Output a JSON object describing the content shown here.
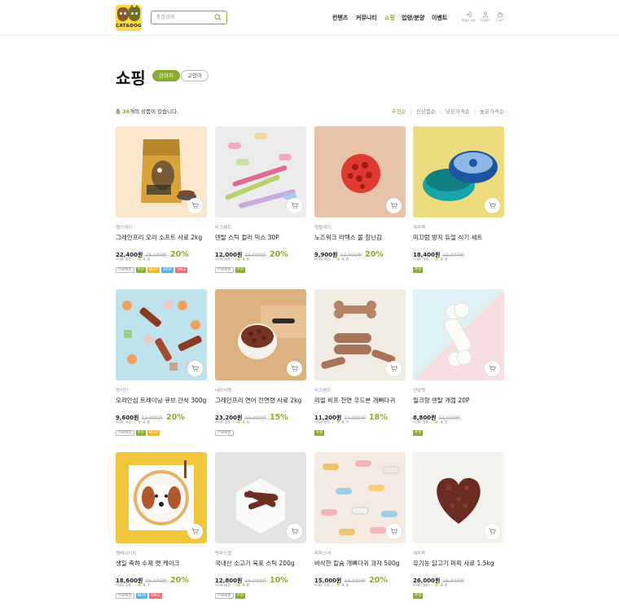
{
  "header": {
    "logo_text": "CAT&DOG",
    "search_placeholder": "통합검색",
    "nav": [
      "컨텐츠",
      "커뮤니티",
      "쇼핑",
      "입양/분양",
      "이벤트"
    ],
    "nav_active": "쇼핑",
    "utils": [
      {
        "label": "Sign up",
        "icon": "signup-icon"
      },
      {
        "label": "Login",
        "icon": "login-icon"
      },
      {
        "label": "Cart",
        "icon": "cart-icon"
      }
    ]
  },
  "page": {
    "title": "쇼핑",
    "categories": [
      "강아지",
      "고양이"
    ],
    "active_category": "강아지",
    "total_prefix": "총 ",
    "total_count": "36",
    "total_suffix": "개의 상품이 있습니다.",
    "sorts": [
      "추천순",
      "신상품순",
      "낮은가격순",
      "높은가격순"
    ],
    "active_sort": "추천순"
  },
  "tag_labels": {
    "free": "무료배송",
    "rec": "추천",
    "best": "BEST",
    "new": "NEW",
    "sale": "SALE"
  },
  "review_label": "리뷰",
  "products": [
    {
      "brand": "펫스테이",
      "name": "그레인프리 오리 소프트 사료 2kg",
      "price": "22,400원",
      "old": "28,000원",
      "disc": "20%",
      "reviews": "53",
      "rating": "4.9",
      "tags": [
        "free",
        "rec",
        "best",
        "new",
        "sale"
      ],
      "image": "food-bag"
    },
    {
      "brand": "바크펜트",
      "name": "덴탈 스틱 컬러 믹스 30P",
      "price": "12,000원",
      "old": "15,000원",
      "disc": "20%",
      "reviews": "65",
      "rating": "4.8",
      "tags": [
        "free",
        "rec"
      ],
      "image": "dental-sticks"
    },
    {
      "brand": "펫플레이",
      "name": "노즈워크 라텍스 볼 장난감",
      "price": "9,900원",
      "old": "12,500원",
      "disc": "20%",
      "reviews": "40",
      "rating": "4.8",
      "tags": [],
      "image": "red-ball"
    },
    {
      "brand": "퍼피팩",
      "name": "미끄럼 방지 듀얼 식기 세트",
      "price": "18,400원",
      "old": "23,000원",
      "disc": "",
      "reviews": "34",
      "rating": "4.9",
      "tags": [
        "rec"
      ],
      "image": "pet-bowl"
    },
    {
      "brand": "펫키친",
      "name": "오리안심 트레이닝 큐브 간식 300g",
      "price": "9,600원",
      "old": "12,000원",
      "disc": "20%",
      "reviews": "43",
      "rating": "4.8",
      "tags": [
        "free",
        "rec",
        "best"
      ],
      "image": "treat-cubes"
    },
    {
      "brand": "네이처펫",
      "name": "그레인프리 연어 전연령 사료 2kg",
      "price": "23,200원",
      "old": "29,000원",
      "disc": "15%",
      "reviews": "15",
      "rating": "4.9",
      "tags": [
        "free"
      ],
      "image": "kibble-bowl"
    },
    {
      "brand": "바크펜트",
      "name": "리얼 비프 천연 우드본 개뼈다귀",
      "price": "11,200원",
      "old": "14,000원",
      "disc": "18%",
      "reviews": "85",
      "rating": "4.7",
      "tags": [
        "rec"
      ],
      "image": "bone-biscuits"
    },
    {
      "brand": "덴탈펫",
      "name": "밀크향 덴탈 개껌 20P",
      "price": "8,800원",
      "old": "11,000원",
      "disc": "",
      "reviews": "34",
      "rating": "4.9",
      "tags": [
        "rec"
      ],
      "image": "white-bone"
    },
    {
      "brand": "펫베이커리",
      "name": "생일 축하 수제 펫 케이크",
      "price": "18,600원",
      "old": "26,500원",
      "disc": "20%",
      "reviews": "14",
      "rating": "4.7",
      "tags": [
        "free",
        "new",
        "sale"
      ],
      "image": "dog-cake"
    },
    {
      "brand": "펫푸드랩",
      "name": "국내산 소고기 육포 스틱 200g",
      "price": "12,800원",
      "old": "16,000원",
      "disc": "10%",
      "reviews": "48",
      "rating": "4.8",
      "tags": [
        "free",
        "rec"
      ],
      "image": "jerky"
    },
    {
      "brand": "퍼피스낵",
      "name": "바삭한 칼슘 개뼈다귀 과자 500g",
      "price": "15,000원",
      "old": "18,000원",
      "disc": "20%",
      "reviews": "56",
      "rating": "4.9",
      "tags": [],
      "image": "colored-bones"
    },
    {
      "brand": "헤피독",
      "name": "유기농 닭고기 퍼피 사료 1.5kg",
      "price": "26,000원",
      "old": "26,500원",
      "disc": "",
      "reviews": "36",
      "rating": "4.9",
      "tags": [
        "rec"
      ],
      "image": "heart-kibble"
    }
  ],
  "colors": {
    "accent": "#8aab32",
    "best": "#f0b52b",
    "new": "#58b2e6",
    "sale": "#ef6f6f",
    "star": "#f2b31b"
  }
}
